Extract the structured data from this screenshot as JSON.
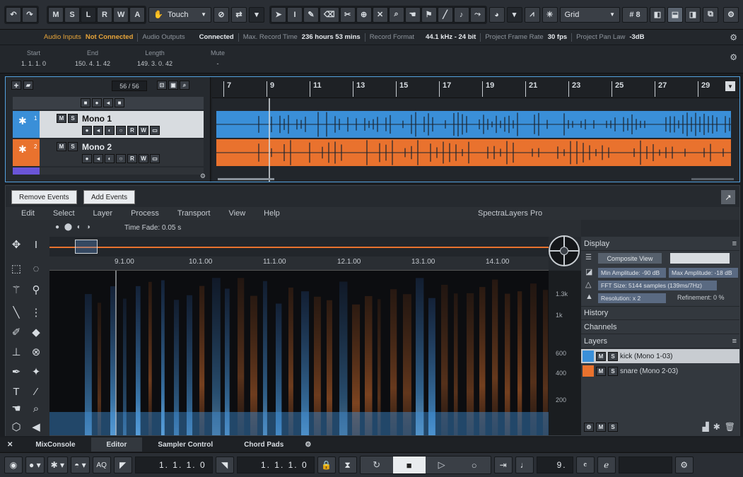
{
  "toolbar": {
    "modes": [
      "M",
      "S",
      "L",
      "R",
      "W",
      "A"
    ],
    "automation_mode": "Touch",
    "grid_type": "Grid",
    "quantize_value": "8"
  },
  "info_line": {
    "audio_inputs_label": "Audio Inputs",
    "audio_inputs_value": "Not Connected",
    "audio_outputs_label": "Audio Outputs",
    "audio_outputs_value": "Connected",
    "max_record_label": "Max. Record Time",
    "max_record_value": "236 hours 53 mins",
    "record_format_label": "Record Format",
    "record_format_value": "44.1 kHz - 24 bit",
    "frame_rate_label": "Project Frame Rate",
    "frame_rate_value": "30 fps",
    "pan_law_label": "Project Pan Law",
    "pan_law_value": "-3dB"
  },
  "selection": {
    "start_label": "Start",
    "start_value": "1. 1. 1. 0",
    "end_label": "End",
    "end_value": "150. 4. 1. 42",
    "length_label": "Length",
    "length_value": "149. 3. 0. 42",
    "mute_label": "Mute",
    "mute_value": "-"
  },
  "project": {
    "track_count": "56 / 56",
    "ruler_bars": [
      "7",
      "9",
      "11",
      "13",
      "15",
      "17",
      "19",
      "21",
      "23",
      "25",
      "27",
      "29"
    ],
    "tracks": [
      {
        "number": "1",
        "name": "Mono 1",
        "color": "#3a8fd8"
      },
      {
        "number": "2",
        "name": "Mono 2",
        "color": "#e9722e"
      }
    ]
  },
  "editor": {
    "remove_events": "Remove Events",
    "add_events": "Add Events",
    "menu": [
      "Edit",
      "Select",
      "Layer",
      "Process",
      "Transport",
      "View",
      "Help"
    ],
    "app_title": "SpectraLayers Pro",
    "time_fade": "Time Fade: 0.05 s",
    "timeline": [
      "9.1.00",
      "10.1.00",
      "11.1.00",
      "12.1.00",
      "13.1.00",
      "14.1.00"
    ],
    "freq_labels": [
      "1.3k",
      "1k",
      "600",
      "400",
      "200"
    ],
    "display": {
      "header": "Display",
      "composite_view": "Composite View",
      "min_amplitude": "Min Amplitude: -90 dB",
      "max_amplitude": "Max Amplitude: -18 dB",
      "fft_size": "FFT Size: 5144 samples (139ms/7Hz)",
      "resolution": "Resolution: x 2",
      "refinement": "Refinement: 0 %"
    },
    "history_header": "History",
    "channels_header": "Channels",
    "layers_header": "Layers",
    "layers": [
      {
        "name": "kick (Mono 1-03)",
        "color": "#3a8fd8"
      },
      {
        "name": "snare (Mono 2-03)",
        "color": "#e9722e"
      }
    ]
  },
  "zone_tabs": [
    "MixConsole",
    "Editor",
    "Sampler Control",
    "Chord Pads"
  ],
  "transport": {
    "left_locator": "1. 1. 1. 0",
    "right_locator": "1. 1. 1. 0",
    "tempo_value": "9."
  }
}
